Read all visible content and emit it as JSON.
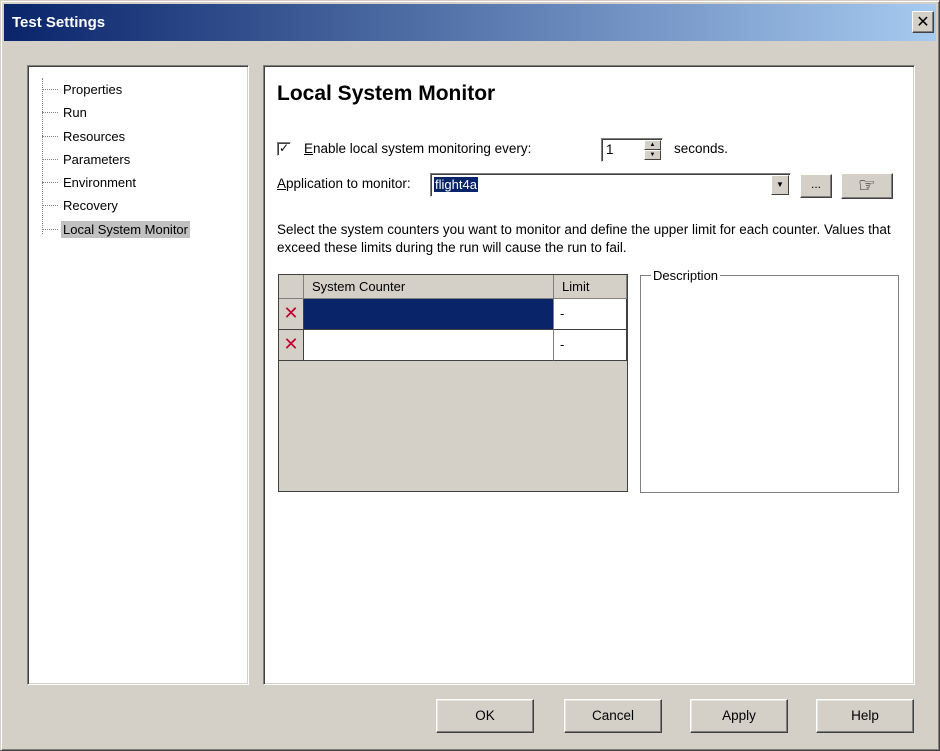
{
  "window": {
    "title": "Test Settings",
    "close_glyph": "✕"
  },
  "tree": {
    "items": [
      {
        "label": "Properties"
      },
      {
        "label": "Run"
      },
      {
        "label": "Resources"
      },
      {
        "label": "Parameters"
      },
      {
        "label": "Environment"
      },
      {
        "label": "Recovery"
      },
      {
        "label": "Local System Monitor"
      }
    ],
    "selected": "Local System Monitor"
  },
  "panel": {
    "title": "Local System Monitor",
    "enable_checkbox": {
      "checked": true,
      "mark": "✓",
      "label_mnemonic": "E",
      "label_rest": "nable local system monitoring every:"
    },
    "interval_value": "1",
    "seconds_label": "seconds.",
    "app_label_mnemonic": "A",
    "app_label_rest": "pplication to monitor:",
    "app_value": "flight4a",
    "browse_label": "...",
    "pointer_icon": "pointing-hand-icon",
    "pointer_glyph": "☞",
    "instructions": "Select the system counters you want to monitor and define the upper limit for each counter. Values that exceed these limits during the run will cause the run to fail.",
    "grid": {
      "columns": [
        "",
        "System Counter",
        "Limit"
      ],
      "rows": [
        {
          "delete_glyph": "✕",
          "counter": "",
          "limit": "-",
          "selected": true
        },
        {
          "delete_glyph": "✕",
          "counter": "",
          "limit": "-",
          "selected": false
        }
      ]
    },
    "description_label": "Description"
  },
  "buttons": {
    "ok": "OK",
    "cancel": "Cancel",
    "apply": "Apply",
    "help": "Help"
  },
  "colors": {
    "titlebar_start": "#0a246a",
    "titlebar_end": "#a6caf0",
    "selection": "#0a246a",
    "delete_icon": "#c00030",
    "face": "#d4d0c8"
  }
}
